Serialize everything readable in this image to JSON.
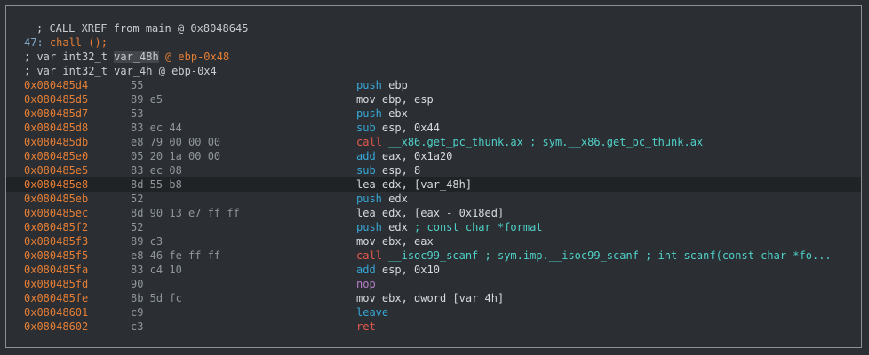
{
  "header": {
    "xref": "; CALL XREF from main @ 0x8048645",
    "func_prefix": "47: ",
    "func_name": "chall ();",
    "var1_prefix": "; var int32_t ",
    "var1_name": "var_48h",
    "var1_suffix": " @ ebp-0x48",
    "var2_line": "; var int32_t var_4h @ ebp-0x4"
  },
  "instructions": [
    {
      "addr": "0x080485d4",
      "bytes": "55",
      "op": "push",
      "mnem_class": "m-push",
      "operands": "ebp"
    },
    {
      "addr": "0x080485d5",
      "bytes": "89 e5",
      "op": "mov",
      "mnem_class": "m-mov",
      "operands": "ebp, esp"
    },
    {
      "addr": "0x080485d7",
      "bytes": "53",
      "op": "push",
      "mnem_class": "m-push",
      "operands": "ebx"
    },
    {
      "addr": "0x080485d8",
      "bytes": "83 ec 44",
      "op": "sub",
      "mnem_class": "m-sub",
      "operands": "esp, 0x44"
    },
    {
      "addr": "0x080485db",
      "bytes": "e8 79 00 00 00",
      "op": "call",
      "mnem_class": "m-call",
      "operands": "__x86.get_pc_thunk.ax",
      "comment": " ; sym.__x86.get_pc_thunk.ax"
    },
    {
      "addr": "0x080485e0",
      "bytes": "05 20 1a 00 00",
      "op": "add",
      "mnem_class": "m-add",
      "operands": "eax, 0x1a20"
    },
    {
      "addr": "0x080485e5",
      "bytes": "83 ec 08",
      "op": "sub",
      "mnem_class": "m-sub",
      "operands": "esp, 8"
    },
    {
      "addr": "0x080485e8",
      "bytes": "8d 55 b8",
      "op": "lea",
      "mnem_class": "m-lea",
      "operands": "edx, [var_48h]",
      "selected": true
    },
    {
      "addr": "0x080485eb",
      "bytes": "52",
      "op": "push",
      "mnem_class": "m-push",
      "operands": "edx"
    },
    {
      "addr": "0x080485ec",
      "bytes": "8d 90 13 e7 ff ff",
      "op": "lea",
      "mnem_class": "m-lea",
      "operands": "edx, [eax - 0x18ed]"
    },
    {
      "addr": "0x080485f2",
      "bytes": "52",
      "op": "push",
      "mnem_class": "m-push",
      "operands": "edx",
      "comment": " ; const char *format"
    },
    {
      "addr": "0x080485f3",
      "bytes": "89 c3",
      "op": "mov",
      "mnem_class": "m-mov",
      "operands": "ebx, eax"
    },
    {
      "addr": "0x080485f5",
      "bytes": "e8 46 fe ff ff",
      "op": "call",
      "mnem_class": "m-call",
      "operands": "__isoc99_scanf",
      "comment": " ; sym.imp.__isoc99_scanf ; int scanf(const char *fo..."
    },
    {
      "addr": "0x080485fa",
      "bytes": "83 c4 10",
      "op": "add",
      "mnem_class": "m-add",
      "operands": "esp, 0x10"
    },
    {
      "addr": "0x080485fd",
      "bytes": "90",
      "op": "nop",
      "mnem_class": "m-nop",
      "operands": ""
    },
    {
      "addr": "0x080485fe",
      "bytes": "8b 5d fc",
      "op": "mov",
      "mnem_class": "m-mov",
      "operands": "ebx, dword [var_4h]"
    },
    {
      "addr": "0x08048601",
      "bytes": "c9",
      "op": "leave",
      "mnem_class": "m-leave",
      "operands": ""
    },
    {
      "addr": "0x08048602",
      "bytes": "c3",
      "op": "ret",
      "mnem_class": "m-ret",
      "operands": ""
    }
  ],
  "colors": {
    "background": "#2b2f33",
    "address": "#e67e35",
    "call": "#e8584c",
    "push": "#37a7d7",
    "nop": "#b77ec9",
    "comment": "#4fd0c8"
  }
}
